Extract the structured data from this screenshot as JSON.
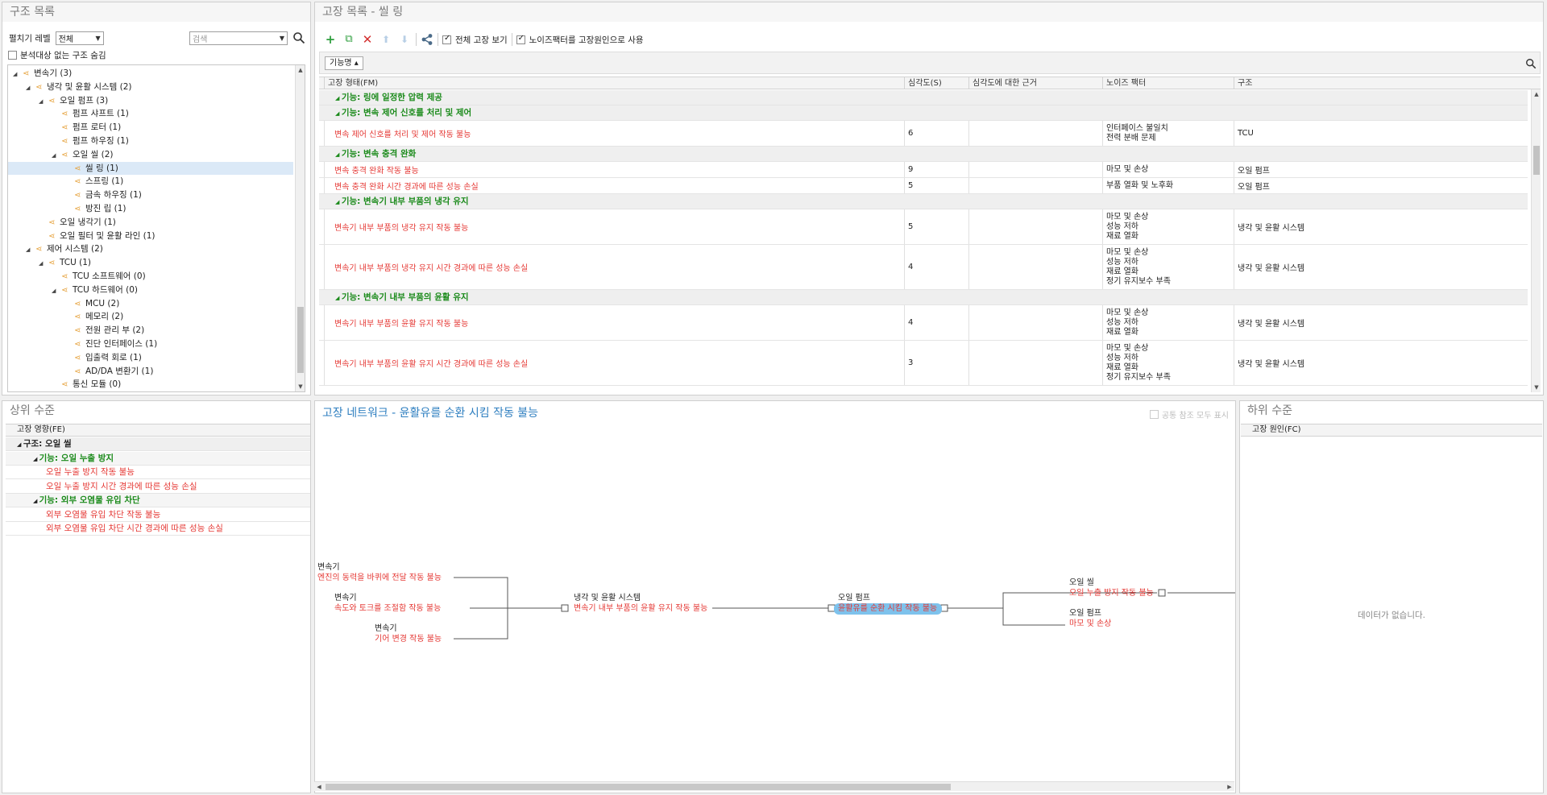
{
  "structure_panel": {
    "title": "구조 목록",
    "level_label": "펼치기 레벨",
    "level_value": "전체",
    "search_placeholder": "검색",
    "hide_label": "분석대상 없는 구조 숨김",
    "tree": [
      {
        "label": "변속기 (3)",
        "depth": 0,
        "expanded": true
      },
      {
        "label": "냉각 및 윤활 시스템 (2)",
        "depth": 1,
        "expanded": true
      },
      {
        "label": "오일 펌프 (3)",
        "depth": 2,
        "expanded": true
      },
      {
        "label": "펌프 샤프트 (1)",
        "depth": 3
      },
      {
        "label": "펌프 로터 (1)",
        "depth": 3
      },
      {
        "label": "펌프 하우징 (1)",
        "depth": 3
      },
      {
        "label": "오일 씰 (2)",
        "depth": 3,
        "expanded": true
      },
      {
        "label": "씰 링 (1)",
        "depth": 4,
        "selected": true
      },
      {
        "label": "스프링 (1)",
        "depth": 4
      },
      {
        "label": "금속 하우징 (1)",
        "depth": 4
      },
      {
        "label": "방진 립 (1)",
        "depth": 4
      },
      {
        "label": "오일 냉각기 (1)",
        "depth": 2
      },
      {
        "label": "오일 필터 및 윤활 라인 (1)",
        "depth": 2
      },
      {
        "label": "제어 시스템 (2)",
        "depth": 1,
        "expanded": true
      },
      {
        "label": "TCU (1)",
        "depth": 2,
        "expanded": true
      },
      {
        "label": "TCU 소프트웨어 (0)",
        "depth": 3
      },
      {
        "label": "TCU 하드웨어 (0)",
        "depth": 3,
        "expanded": true
      },
      {
        "label": "MCU (2)",
        "depth": 4
      },
      {
        "label": "메모리 (2)",
        "depth": 4
      },
      {
        "label": "전원 관리 부 (2)",
        "depth": 4
      },
      {
        "label": "진단 인터페이스 (1)",
        "depth": 4
      },
      {
        "label": "입출력 회로 (1)",
        "depth": 4
      },
      {
        "label": "AD/DA 변환기 (1)",
        "depth": 4
      },
      {
        "label": "통신 모듈 (0)",
        "depth": 3
      }
    ]
  },
  "failure_panel": {
    "title": "고장 목록 - 씰 링",
    "show_all_label": "전체 고장 보기",
    "noise_label": "노이즈팩터를 고장원인으로 사용",
    "group_by": "기능명 ▴",
    "columns": [
      "고장 형태(FM)",
      "심각도(S)",
      "심각도에 대한 근거",
      "노이즈 팩터",
      "구조"
    ],
    "rows": [
      {
        "type": "group",
        "label": "기능: 링에 일정한 압력 제공"
      },
      {
        "type": "group",
        "label": "기능: 변속 제어 신호를 처리 및 제어"
      },
      {
        "type": "row",
        "fm": "변속 제어 신호를 처리 및 제어 작동 불능",
        "s": "6",
        "noise": [
          "인터페이스 불일치",
          "전력 분배 문제"
        ],
        "struct": "TCU"
      },
      {
        "type": "group",
        "label": "기능: 변속 충격 완화"
      },
      {
        "type": "row",
        "fm": "변속 충격 완화 작동 불능",
        "s": "9",
        "noise": [
          "마모 및 손상"
        ],
        "struct": "오일 펌프"
      },
      {
        "type": "row",
        "fm": "변속 충격 완화 시간 경과에 따른 성능 손실",
        "s": "5",
        "noise": [
          "부품 열화 및 노후화"
        ],
        "struct": "오일 펌프"
      },
      {
        "type": "group",
        "label": "기능: 변속기 내부 부품의 냉각 유지"
      },
      {
        "type": "row",
        "fm": "변속기 내부 부품의 냉각 유지 작동 불능",
        "s": "5",
        "noise": [
          "마모 및 손상",
          "성능 저하",
          "재료 열화"
        ],
        "struct": "냉각 및 윤활 시스템"
      },
      {
        "type": "row",
        "fm": "변속기 내부 부품의 냉각 유지 시간 경과에 따른 성능 손실",
        "s": "4",
        "noise": [
          "마모 및 손상",
          "성능 저하",
          "재료 열화",
          "정기 유지보수 부족"
        ],
        "struct": "냉각 및 윤활 시스템"
      },
      {
        "type": "group",
        "label": "기능: 변속기 내부 부품의 윤활 유지"
      },
      {
        "type": "row",
        "fm": "변속기 내부 부품의 윤활 유지 작동 불능",
        "s": "4",
        "noise": [
          "마모 및 손상",
          "성능 저하",
          "재료 열화"
        ],
        "struct": "냉각 및 윤활 시스템"
      },
      {
        "type": "row",
        "fm": "변속기 내부 부품의 윤활 유지 시간 경과에 따른 성능 손실",
        "s": "3",
        "noise": [
          "마모 및 손상",
          "성능 저하",
          "재료 열화",
          "정기 유지보수 부족"
        ],
        "struct": "냉각 및 윤활 시스템"
      }
    ]
  },
  "upper_panel": {
    "title": "상위 수준",
    "column": "고장 영향(FE)",
    "rows": [
      {
        "kind": "struct",
        "label": "구조: 오일 씰"
      },
      {
        "kind": "func",
        "label": "기능: 오일 누출 방지"
      },
      {
        "kind": "fe",
        "label": "오일 누출 방지 작동 불능"
      },
      {
        "kind": "fe",
        "label": "오일 누출 방지 시간 경과에 따른 성능 손실"
      },
      {
        "kind": "func",
        "label": "기능: 외부 오염물 유입 차단"
      },
      {
        "kind": "fe",
        "label": "외부 오염물 유입 차단 작동 불능"
      },
      {
        "kind": "fe",
        "label": "외부 오염물 유입 차단 시간 경과에 따른 성능 손실"
      }
    ]
  },
  "network_panel": {
    "title": "고장 네트워크 - 윤활유를 순환 시킴 작동 불능",
    "show_common_label": "공통 참조 모두 표시",
    "nodes": [
      {
        "id": "n1",
        "struct": "변속기",
        "fail": "엔진의 동력을 바퀴에 전달 작동 불능"
      },
      {
        "id": "n2",
        "struct": "변속기",
        "fail": "속도와 토크를 조절함 작동 불능"
      },
      {
        "id": "n3",
        "struct": "변속기",
        "fail": "기어 변경 작동 불능"
      },
      {
        "id": "n4",
        "struct": "냉각 및 윤활 시스템",
        "fail": "변속기 내부 부품의 윤활 유지 작동 불능"
      },
      {
        "id": "n5",
        "struct": "오일 펌프",
        "fail": "윤활유를 순환 시킴 작동 불능"
      },
      {
        "id": "n6",
        "struct": "오일 씰",
        "fail": "오일 누출 방지 작동 불능"
      },
      {
        "id": "n7",
        "struct": "오일 펌프",
        "fail": "마모 및 손상"
      }
    ]
  },
  "lower_panel": {
    "title": "하위 수준",
    "column": "고장 원인(FC)",
    "empty": "데이터가 없습니다."
  }
}
